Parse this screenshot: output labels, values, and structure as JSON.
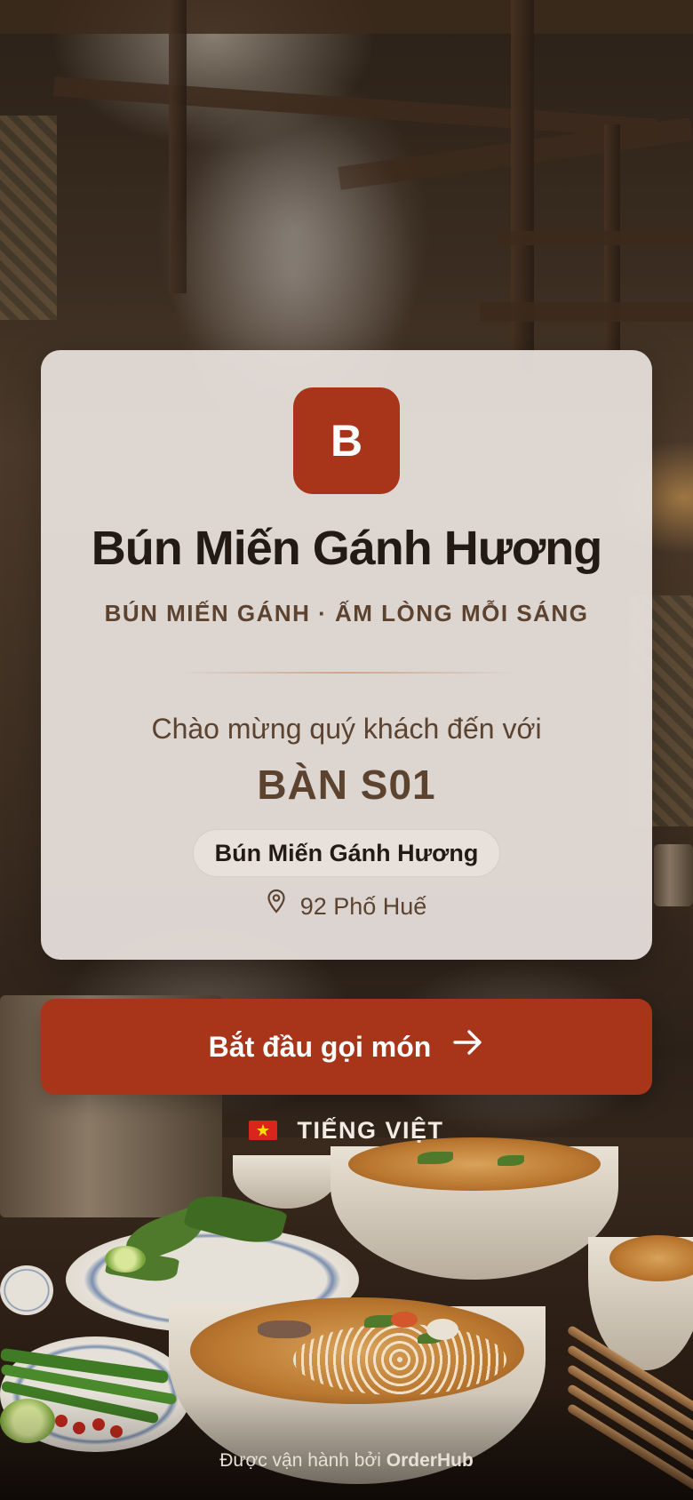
{
  "restaurant": {
    "logo_letter": "B",
    "name": "Bún Miến Gánh Hương",
    "tagline": "BÚN MIẾN GÁNH · ẤM LÒNG MỖI SÁNG"
  },
  "welcome": {
    "greeting": "Chào mừng quý khách đến với",
    "table_label": "BÀN S01"
  },
  "branch": {
    "name": "Bún Miến Gánh Hương",
    "address": "92 Phố Huế",
    "address_icon": "map-pin-icon"
  },
  "actions": {
    "start_order_label": "Bắt đầu gọi món",
    "start_order_icon": "arrow-right-icon"
  },
  "language": {
    "flag_icon": "vietnam-flag-icon",
    "label": "TIẾNG VIỆT"
  },
  "footer": {
    "prefix": "Được vận hành bởi",
    "brand": "OrderHub"
  },
  "colors": {
    "accent": "#a8351a",
    "heading": "#231a13",
    "text_muted": "#5c4330",
    "card_bg": "#e8e2de"
  }
}
